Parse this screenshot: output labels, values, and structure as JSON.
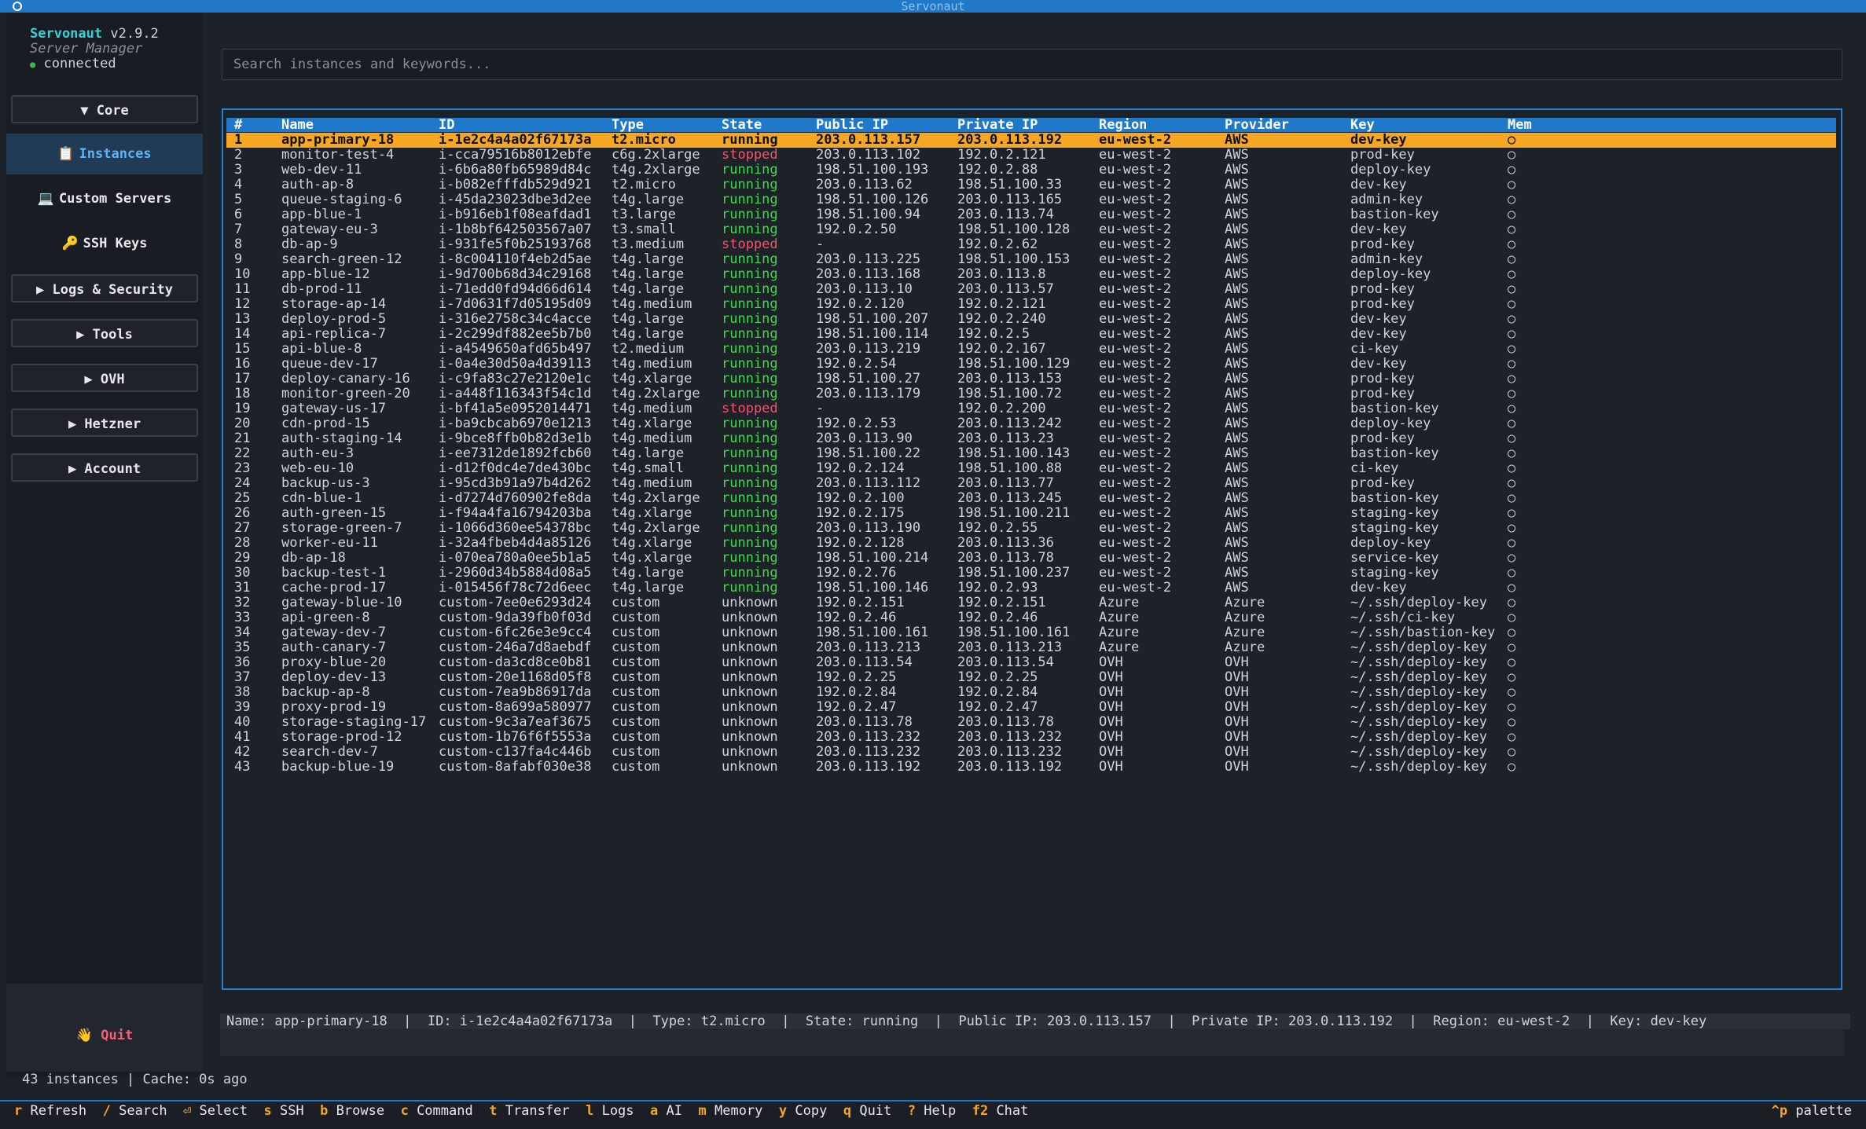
{
  "window": {
    "title": "Servonaut"
  },
  "sidebar": {
    "app_name": "Servonaut",
    "version": "v2.9.2",
    "subtitle": "Server Manager",
    "status": "connected",
    "sections": [
      {
        "label": "▼ Core"
      },
      {
        "label": "▶ Logs & Security"
      },
      {
        "label": "▶ Tools"
      },
      {
        "label": "▶ OVH"
      },
      {
        "label": "▶ Hetzner"
      },
      {
        "label": "▶ Account"
      }
    ],
    "items": [
      {
        "icon": "📋",
        "label": "Instances",
        "active": true
      },
      {
        "icon": "💻",
        "label": "Custom Servers",
        "active": false
      },
      {
        "icon": "🔑",
        "label": "SSH Keys",
        "active": false
      }
    ],
    "quit": {
      "icon": "👋",
      "label": "Quit"
    }
  },
  "search": {
    "placeholder": "Search instances and keywords..."
  },
  "table": {
    "columns": [
      "#",
      "Name",
      "ID",
      "Type",
      "State",
      "Public IP",
      "Private IP",
      "Region",
      "Provider",
      "Key",
      "Mem"
    ],
    "selected_index": 0,
    "rows": [
      [
        "1",
        "app-primary-18",
        "i-1e2c4a4a02f67173a",
        "t2.micro",
        "running",
        "203.0.113.157",
        "203.0.113.192",
        "eu-west-2",
        "AWS",
        "dev-key",
        "○"
      ],
      [
        "2",
        "monitor-test-4",
        "i-cca79516b8012ebfe",
        "c6g.2xlarge",
        "stopped",
        "203.0.113.102",
        "192.0.2.121",
        "eu-west-2",
        "AWS",
        "prod-key",
        "○"
      ],
      [
        "3",
        "web-dev-11",
        "i-6b6a80fb65989d84c",
        "t4g.2xlarge",
        "running",
        "198.51.100.193",
        "192.0.2.88",
        "eu-west-2",
        "AWS",
        "deploy-key",
        "○"
      ],
      [
        "4",
        "auth-ap-8",
        "i-b082efffdb529d921",
        "t2.micro",
        "running",
        "203.0.113.62",
        "198.51.100.33",
        "eu-west-2",
        "AWS",
        "dev-key",
        "○"
      ],
      [
        "5",
        "queue-staging-6",
        "i-45da23023dbe3d2ee",
        "t4g.large",
        "running",
        "198.51.100.126",
        "203.0.113.165",
        "eu-west-2",
        "AWS",
        "admin-key",
        "○"
      ],
      [
        "6",
        "app-blue-1",
        "i-b916eb1f08eafdad1",
        "t3.large",
        "running",
        "198.51.100.94",
        "203.0.113.74",
        "eu-west-2",
        "AWS",
        "bastion-key",
        "○"
      ],
      [
        "7",
        "gateway-eu-3",
        "i-1b8bf642503567a07",
        "t3.small",
        "running",
        "192.0.2.50",
        "198.51.100.128",
        "eu-west-2",
        "AWS",
        "dev-key",
        "○"
      ],
      [
        "8",
        "db-ap-9",
        "i-931fe5f0b25193768",
        "t3.medium",
        "stopped",
        "-",
        "192.0.2.62",
        "eu-west-2",
        "AWS",
        "prod-key",
        "○"
      ],
      [
        "9",
        "search-green-12",
        "i-8c004110f4eb2d5ae",
        "t4g.large",
        "running",
        "203.0.113.225",
        "198.51.100.153",
        "eu-west-2",
        "AWS",
        "admin-key",
        "○"
      ],
      [
        "10",
        "app-blue-12",
        "i-9d700b68d34c29168",
        "t4g.large",
        "running",
        "203.0.113.168",
        "203.0.113.8",
        "eu-west-2",
        "AWS",
        "deploy-key",
        "○"
      ],
      [
        "11",
        "db-prod-11",
        "i-71edd0fd94d66d614",
        "t4g.large",
        "running",
        "203.0.113.10",
        "203.0.113.57",
        "eu-west-2",
        "AWS",
        "prod-key",
        "○"
      ],
      [
        "12",
        "storage-ap-14",
        "i-7d0631f7d05195d09",
        "t4g.medium",
        "running",
        "192.0.2.120",
        "192.0.2.121",
        "eu-west-2",
        "AWS",
        "prod-key",
        "○"
      ],
      [
        "13",
        "deploy-prod-5",
        "i-316e2758c34c4acce",
        "t4g.large",
        "running",
        "198.51.100.207",
        "192.0.2.240",
        "eu-west-2",
        "AWS",
        "dev-key",
        "○"
      ],
      [
        "14",
        "api-replica-7",
        "i-2c299df882ee5b7b0",
        "t4g.large",
        "running",
        "198.51.100.114",
        "192.0.2.5",
        "eu-west-2",
        "AWS",
        "dev-key",
        "○"
      ],
      [
        "15",
        "api-blue-8",
        "i-a4549650afd65b497",
        "t2.medium",
        "running",
        "203.0.113.219",
        "192.0.2.167",
        "eu-west-2",
        "AWS",
        "ci-key",
        "○"
      ],
      [
        "16",
        "queue-dev-17",
        "i-0a4e30d50a4d39113",
        "t4g.medium",
        "running",
        "192.0.2.54",
        "198.51.100.129",
        "eu-west-2",
        "AWS",
        "dev-key",
        "○"
      ],
      [
        "17",
        "deploy-canary-16",
        "i-c9fa83c27e2120e1c",
        "t4g.xlarge",
        "running",
        "198.51.100.27",
        "203.0.113.153",
        "eu-west-2",
        "AWS",
        "prod-key",
        "○"
      ],
      [
        "18",
        "monitor-green-20",
        "i-a448f116343f54c1d",
        "t4g.2xlarge",
        "running",
        "203.0.113.179",
        "198.51.100.72",
        "eu-west-2",
        "AWS",
        "prod-key",
        "○"
      ],
      [
        "19",
        "gateway-us-17",
        "i-bf41a5e0952014471",
        "t4g.medium",
        "stopped",
        "-",
        "192.0.2.200",
        "eu-west-2",
        "AWS",
        "bastion-key",
        "○"
      ],
      [
        "20",
        "cdn-prod-15",
        "i-ba9cbcab6970e1213",
        "t4g.xlarge",
        "running",
        "192.0.2.53",
        "203.0.113.242",
        "eu-west-2",
        "AWS",
        "deploy-key",
        "○"
      ],
      [
        "21",
        "auth-staging-14",
        "i-9bce8ffb0b82d3e1b",
        "t4g.medium",
        "running",
        "203.0.113.90",
        "203.0.113.23",
        "eu-west-2",
        "AWS",
        "prod-key",
        "○"
      ],
      [
        "22",
        "auth-eu-3",
        "i-ee7312de1892fcb60",
        "t4g.large",
        "running",
        "198.51.100.22",
        "198.51.100.143",
        "eu-west-2",
        "AWS",
        "bastion-key",
        "○"
      ],
      [
        "23",
        "web-eu-10",
        "i-d12f0dc4e7de430bc",
        "t4g.small",
        "running",
        "192.0.2.124",
        "198.51.100.88",
        "eu-west-2",
        "AWS",
        "ci-key",
        "○"
      ],
      [
        "24",
        "backup-us-3",
        "i-95cd3b91a97b4d262",
        "t4g.medium",
        "running",
        "203.0.113.112",
        "203.0.113.77",
        "eu-west-2",
        "AWS",
        "prod-key",
        "○"
      ],
      [
        "25",
        "cdn-blue-1",
        "i-d7274d760902fe8da",
        "t4g.2xlarge",
        "running",
        "192.0.2.100",
        "203.0.113.245",
        "eu-west-2",
        "AWS",
        "bastion-key",
        "○"
      ],
      [
        "26",
        "auth-green-15",
        "i-f94a4fa16794203ba",
        "t4g.xlarge",
        "running",
        "192.0.2.175",
        "198.51.100.211",
        "eu-west-2",
        "AWS",
        "staging-key",
        "○"
      ],
      [
        "27",
        "storage-green-7",
        "i-1066d360ee54378bc",
        "t4g.2xlarge",
        "running",
        "203.0.113.190",
        "192.0.2.55",
        "eu-west-2",
        "AWS",
        "staging-key",
        "○"
      ],
      [
        "28",
        "worker-eu-11",
        "i-32a4fbeb4d4a85126",
        "t4g.xlarge",
        "running",
        "192.0.2.128",
        "203.0.113.36",
        "eu-west-2",
        "AWS",
        "deploy-key",
        "○"
      ],
      [
        "29",
        "db-ap-18",
        "i-070ea780a0ee5b1a5",
        "t4g.xlarge",
        "running",
        "198.51.100.214",
        "203.0.113.78",
        "eu-west-2",
        "AWS",
        "service-key",
        "○"
      ],
      [
        "30",
        "backup-test-1",
        "i-2960d34b5884d08a5",
        "t4g.large",
        "running",
        "192.0.2.76",
        "198.51.100.237",
        "eu-west-2",
        "AWS",
        "staging-key",
        "○"
      ],
      [
        "31",
        "cache-prod-17",
        "i-015456f78c72d6eec",
        "t4g.large",
        "running",
        "198.51.100.146",
        "192.0.2.93",
        "eu-west-2",
        "AWS",
        "dev-key",
        "○"
      ],
      [
        "32",
        "gateway-blue-10",
        "custom-7ee0e6293d24",
        "custom",
        "unknown",
        "192.0.2.151",
        "192.0.2.151",
        "Azure",
        "Azure",
        "~/.ssh/deploy-key",
        "○"
      ],
      [
        "33",
        "api-green-8",
        "custom-9da39fb0f03d",
        "custom",
        "unknown",
        "192.0.2.46",
        "192.0.2.46",
        "Azure",
        "Azure",
        "~/.ssh/ci-key",
        "○"
      ],
      [
        "34",
        "gateway-dev-7",
        "custom-6fc26e3e9cc4",
        "custom",
        "unknown",
        "198.51.100.161",
        "198.51.100.161",
        "Azure",
        "Azure",
        "~/.ssh/bastion-key",
        "○"
      ],
      [
        "35",
        "auth-canary-7",
        "custom-246a7d8aebdf",
        "custom",
        "unknown",
        "203.0.113.213",
        "203.0.113.213",
        "Azure",
        "Azure",
        "~/.ssh/deploy-key",
        "○"
      ],
      [
        "36",
        "proxy-blue-20",
        "custom-da3cd8ce0b81",
        "custom",
        "unknown",
        "203.0.113.54",
        "203.0.113.54",
        "OVH",
        "OVH",
        "~/.ssh/deploy-key",
        "○"
      ],
      [
        "37",
        "deploy-dev-13",
        "custom-20e1168d05f8",
        "custom",
        "unknown",
        "192.0.2.25",
        "192.0.2.25",
        "OVH",
        "OVH",
        "~/.ssh/deploy-key",
        "○"
      ],
      [
        "38",
        "backup-ap-8",
        "custom-7ea9b86917da",
        "custom",
        "unknown",
        "192.0.2.84",
        "192.0.2.84",
        "OVH",
        "OVH",
        "~/.ssh/deploy-key",
        "○"
      ],
      [
        "39",
        "proxy-prod-19",
        "custom-8a699a580977",
        "custom",
        "unknown",
        "192.0.2.47",
        "192.0.2.47",
        "OVH",
        "OVH",
        "~/.ssh/deploy-key",
        "○"
      ],
      [
        "40",
        "storage-staging-17",
        "custom-9c3a7eaf3675",
        "custom",
        "unknown",
        "203.0.113.78",
        "203.0.113.78",
        "OVH",
        "OVH",
        "~/.ssh/deploy-key",
        "○"
      ],
      [
        "41",
        "storage-prod-12",
        "custom-1b76f6f5553a",
        "custom",
        "unknown",
        "203.0.113.232",
        "203.0.113.232",
        "OVH",
        "OVH",
        "~/.ssh/deploy-key",
        "○"
      ],
      [
        "42",
        "search-dev-7",
        "custom-c137fa4c446b",
        "custom",
        "unknown",
        "203.0.113.232",
        "203.0.113.232",
        "OVH",
        "OVH",
        "~/.ssh/deploy-key",
        "○"
      ],
      [
        "43",
        "backup-blue-19",
        "custom-8afabf030e38",
        "custom",
        "unknown",
        "203.0.113.192",
        "203.0.113.192",
        "OVH",
        "OVH",
        "~/.ssh/deploy-key",
        "○"
      ]
    ]
  },
  "details": {
    "text": "Name: app-primary-18  |  ID: i-1e2c4a4a02f67173a  |  Type: t2.micro  |  State: running  |  Public IP: 203.0.113.157  |  Private IP: 203.0.113.192  |  Region: eu-west-2  |  Key: dev-key"
  },
  "status": {
    "text": "43 instances | Cache: 0s ago"
  },
  "keybar": {
    "bindings": [
      {
        "key": "r",
        "label": "Refresh"
      },
      {
        "key": "/",
        "label": "Search"
      },
      {
        "key": "⏎",
        "label": "Select"
      },
      {
        "key": "s",
        "label": "SSH"
      },
      {
        "key": "b",
        "label": "Browse"
      },
      {
        "key": "c",
        "label": "Command"
      },
      {
        "key": "t",
        "label": "Transfer"
      },
      {
        "key": "l",
        "label": "Logs"
      },
      {
        "key": "a",
        "label": "AI"
      },
      {
        "key": "m",
        "label": "Memory"
      },
      {
        "key": "y",
        "label": "Copy"
      },
      {
        "key": "q",
        "label": "Quit"
      },
      {
        "key": "?",
        "label": "Help"
      },
      {
        "key": "f2",
        "label": "Chat"
      }
    ],
    "palette": {
      "key": "^p",
      "label": "palette"
    }
  },
  "colors": {
    "accent": "#1f78c8",
    "selected_row": "#f5a623",
    "running": "#3fd84a",
    "stopped": "#ff4d6d",
    "brand": "#33d1d8"
  }
}
